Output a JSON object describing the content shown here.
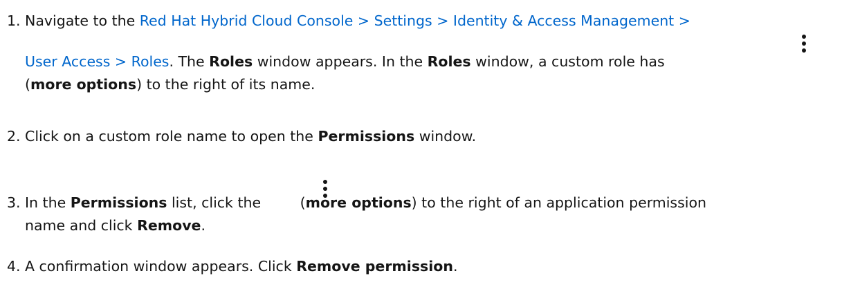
{
  "steps": [
    {
      "number": "1.",
      "intro": "Navigate to the ",
      "breadcrumb_line1": "Red Hat Hybrid Cloud Console > Settings > Identity & Access Management >",
      "breadcrumb_line2": "User Access > Roles",
      "t1": ". The ",
      "b1": "Roles",
      "t2": " window appears. In the ",
      "b2": "Roles",
      "t3": " window, a custom role has",
      "open_paren": "(",
      "bold_more_options": "more options",
      "t4": ") to the right of its name.",
      "icon": "more-options-kebab-icon"
    },
    {
      "number": "2.",
      "t1": "Click on a custom role name to open the ",
      "b1": "Permissions",
      "t2": " window."
    },
    {
      "number": "3.",
      "t1": "In the ",
      "b1": "Permissions",
      "t2": " list, click the ",
      "t3": "(",
      "b2": "more options",
      "t4": ") to the right of an application permission",
      "t5": "name and click ",
      "b3": "Remove",
      "t6": ".",
      "icon": "more-options-kebab-icon"
    },
    {
      "number": "4.",
      "t1": "A confirmation window appears. Click ",
      "b1": "Remove permission",
      "t2": "."
    }
  ]
}
